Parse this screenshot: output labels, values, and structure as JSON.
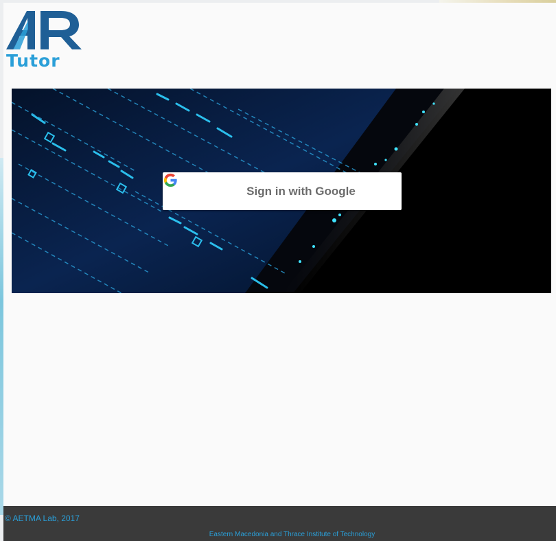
{
  "brand": {
    "logo_letters": "AR",
    "logo_word": "Tutor"
  },
  "login": {
    "google_button_label": "Sign in with Google"
  },
  "footer": {
    "copyright": "© AETMA Lab, 2017",
    "institute": "Eastern Macedonia and Thrace Institute of Technology"
  },
  "colors": {
    "brand_blue": "#2a9fd8",
    "brand_dark_blue": "#1f5f96",
    "footer_bg": "#3a3a3a",
    "hero_bg": "#000000",
    "hero_glow": "#2fd0ff"
  },
  "icons": {
    "google": "google-g-icon"
  }
}
